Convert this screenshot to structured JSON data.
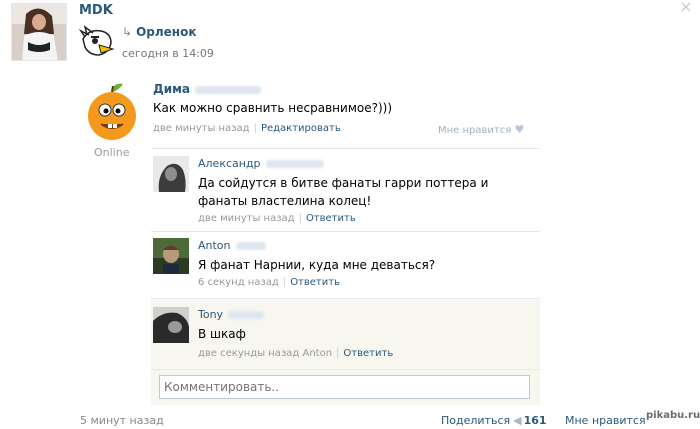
{
  "group": {
    "name": "MDK"
  },
  "repost": {
    "source": "Орленок",
    "time": "сегодня в 14:09"
  },
  "post": {
    "author": "Дима",
    "status": "Online",
    "text": "Как можно сравнить несравнимое?)))",
    "time": "две минуты назад",
    "edit_label": "Редактировать",
    "like_label": "Мне нравится"
  },
  "comments": [
    {
      "author": "Александр",
      "text": "Да сойдутся в битве фанаты гарри поттера и фанаты властелина колец!",
      "time": "две минуты назад",
      "reply_label": "Ответить"
    },
    {
      "author": "Anton",
      "text": "Я фанат Нарнии, куда мне деваться?",
      "time": "6 секунд назад",
      "reply_label": "Ответить"
    },
    {
      "author": "Tony",
      "text": "В шкаф",
      "time": "две секунды назад Anton",
      "reply_label": "Ответить"
    }
  ],
  "reply": {
    "placeholder": "Комментировать.."
  },
  "footer": {
    "time": "5 минут назад",
    "share_label": "Поделиться",
    "share_count": "161",
    "like_label": "Мне нравится",
    "watermark": "pikabu.ru"
  },
  "icons": {
    "close": "close-icon",
    "repost": "repost-arrow-icon",
    "heart": "heart-icon",
    "megaphone": "megaphone-icon"
  }
}
